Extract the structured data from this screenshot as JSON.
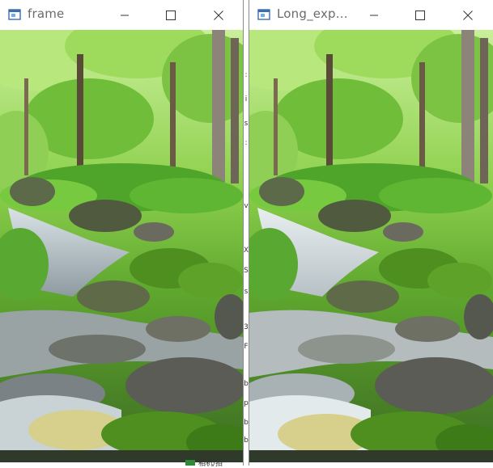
{
  "windows": [
    {
      "title": "frame",
      "controls": {
        "minimize": "minimize",
        "maximize": "maximize",
        "close": "close"
      }
    },
    {
      "title": "Long_exp...",
      "controls": {
        "minimize": "minimize",
        "maximize": "maximize",
        "close": "close"
      }
    }
  ],
  "icons": {
    "app": "app-window-icon",
    "minimize": "minimize-icon",
    "maximize": "maximize-icon",
    "close": "close-icon"
  },
  "colors": {
    "title_text": "#6b6b6b",
    "foliage_light": "#8fd14f",
    "foliage_dark": "#2e6b1c",
    "rock": "#55584f",
    "water": "#e8eef0",
    "moss": "#4e8f1f"
  },
  "background_fragments": [
    ":",
    "i",
    "s",
    ":",
    "v",
    "X",
    "S",
    "s",
    "3",
    "F",
    "b",
    "p",
    "b",
    "b"
  ],
  "taskbar_fragment": "相机/拍"
}
